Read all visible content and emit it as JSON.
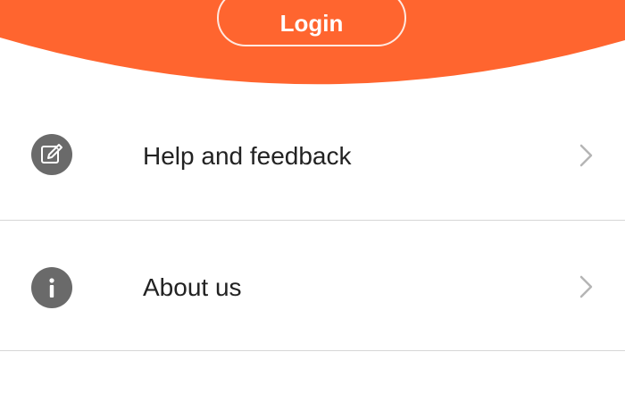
{
  "header": {
    "login_label": "Login",
    "accent_color": "#FF652F"
  },
  "menu": {
    "items": [
      {
        "label": "Help and feedback",
        "icon": "edit-note-icon",
        "trailing_icon": "chevron-right-icon"
      },
      {
        "label": "About us",
        "icon": "info-icon",
        "trailing_icon": "chevron-right-icon"
      }
    ]
  }
}
